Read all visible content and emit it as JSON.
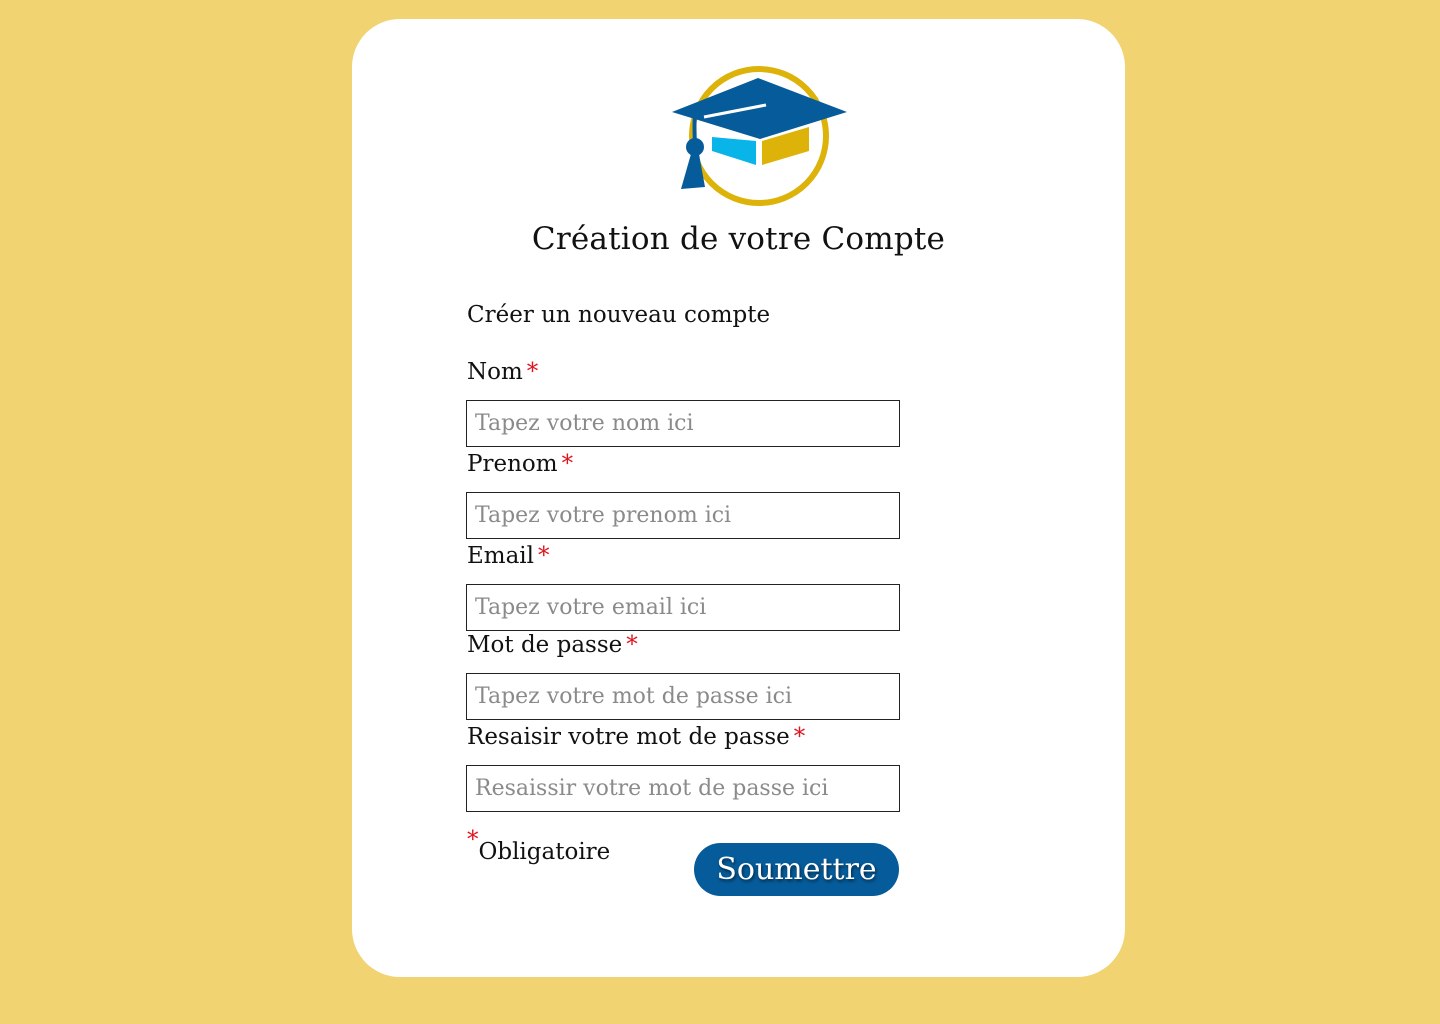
{
  "header": {
    "logo_icon": "graduation-cap-logo",
    "title": "Création de votre Compte"
  },
  "form": {
    "subtitle": "Créer un nouveau compte",
    "required_marker": "*",
    "fields": [
      {
        "label": "Nom",
        "placeholder": "Tapez votre nom ici",
        "value": ""
      },
      {
        "label": "Prenom",
        "placeholder": "Tapez votre prenom ici",
        "value": ""
      },
      {
        "label": "Email",
        "placeholder": "Tapez votre email ici",
        "value": ""
      },
      {
        "label": "Mot de passe",
        "placeholder": "Tapez votre mot de passe ici",
        "value": ""
      },
      {
        "label": "Resaisir votre mot de passe",
        "placeholder": "Resaissir votre mot de passe ici",
        "value": ""
      }
    ],
    "required_note": "Obligatoire",
    "submit_label": "Soumettre"
  },
  "colors": {
    "background": "#F1D371",
    "card": "#FFFFFF",
    "primary": "#065C9B",
    "accent_gold": "#DDB30A",
    "accent_cyan": "#09B4E8",
    "required": "#E0141E"
  }
}
